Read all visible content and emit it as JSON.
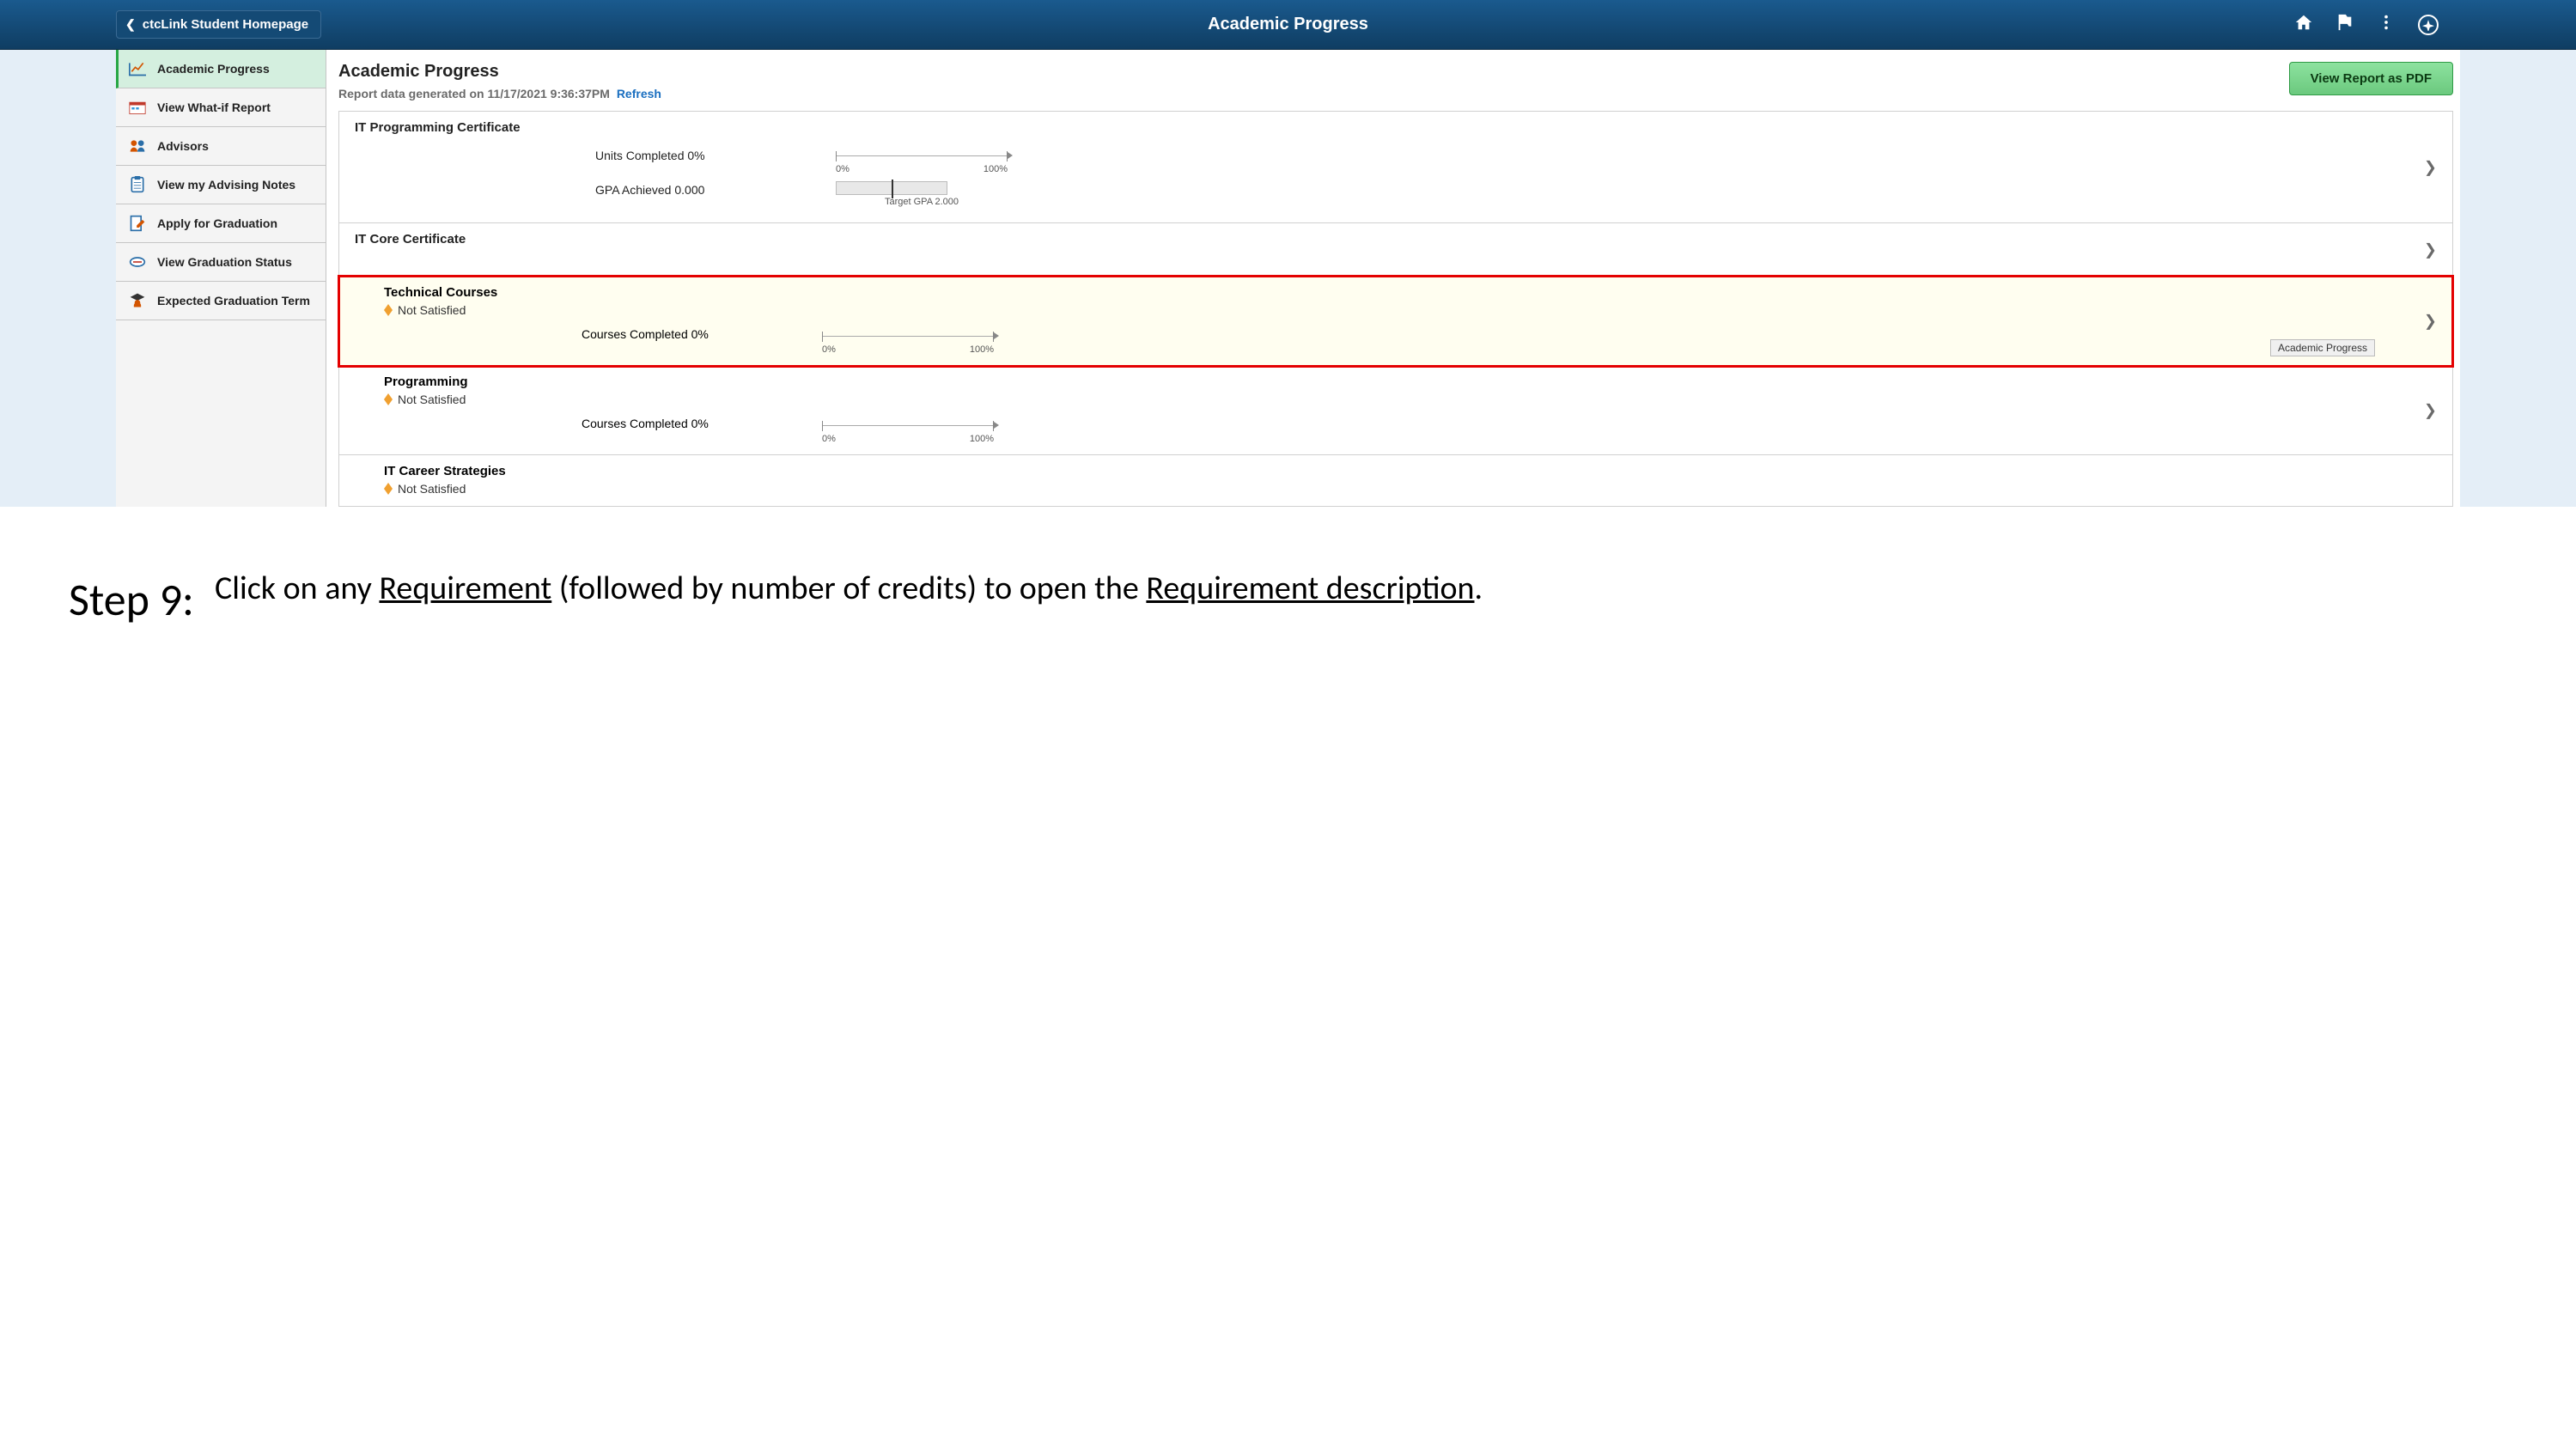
{
  "topbar": {
    "back_label": "ctcLink Student Homepage",
    "title": "Academic Progress"
  },
  "sidebar": {
    "items": [
      {
        "label": "Academic Progress"
      },
      {
        "label": "View What-if Report"
      },
      {
        "label": "Advisors"
      },
      {
        "label": "View my Advising Notes"
      },
      {
        "label": "Apply for Graduation"
      },
      {
        "label": "View Graduation Status"
      },
      {
        "label": "Expected Graduation Term"
      }
    ]
  },
  "content": {
    "heading": "Academic Progress",
    "report_line": "Report data generated on 11/17/2021 9:36:37PM",
    "refresh_label": "Refresh",
    "pdf_button": "View Report as PDF"
  },
  "sections": {
    "prog_cert": {
      "title": "IT Programming Certificate",
      "units_label": "Units Completed 0%",
      "gpa_label": "GPA Achieved  0.000",
      "pct_low": "0%",
      "pct_high": "100%",
      "gpa_target": "Target GPA 2.000"
    },
    "core_cert": {
      "title": "IT Core Certificate"
    },
    "tech": {
      "title": "Technical Courses",
      "status": "Not Satisfied",
      "metric": "Courses Completed 0%",
      "pct_low": "0%",
      "pct_high": "100%",
      "tooltip": "Academic Progress"
    },
    "programming": {
      "title": "Programming",
      "status": "Not Satisfied",
      "metric": "Courses Completed 0%",
      "pct_low": "0%",
      "pct_high": "100%"
    },
    "career": {
      "title": "IT Career Strategies",
      "status": "Not Satisfied"
    }
  },
  "instruction": {
    "step_label": "Step 9:",
    "text_1": "Click on any ",
    "text_req": "Requirement",
    "text_2": " (followed by number of credits) to open the ",
    "text_desc": "Requirement description",
    "text_3": "."
  }
}
